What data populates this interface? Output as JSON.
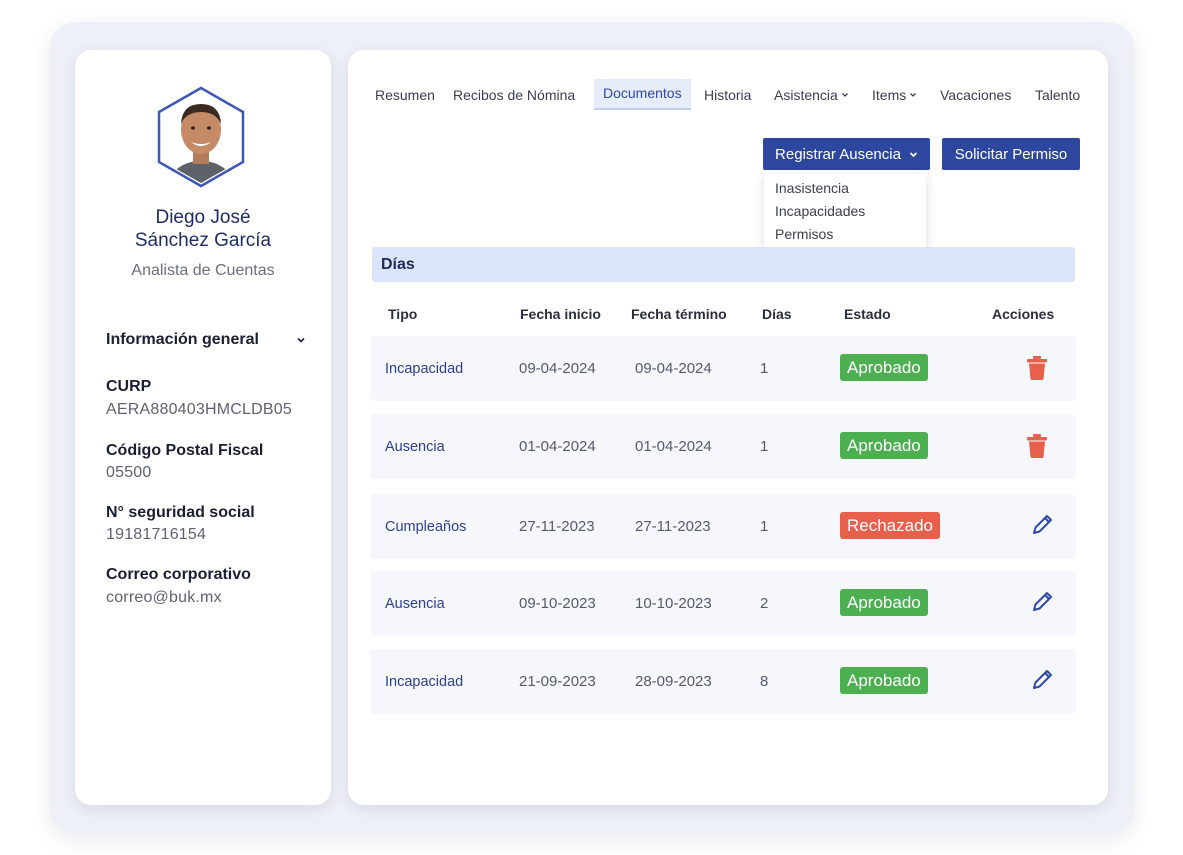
{
  "profile": {
    "first_name": "Diego José",
    "last_name": "Sánchez García",
    "role": "Analista de Cuentas",
    "info_header": "Información general",
    "fields": [
      {
        "label": "CURP",
        "value": "AERA880403HMCLDB05"
      },
      {
        "label": "Código Postal Fiscal",
        "value": "05500"
      },
      {
        "label": "N° seguridad social",
        "value": "19181716154"
      },
      {
        "label": "Correo corporativo",
        "value": "correo@buk.mx"
      }
    ]
  },
  "tabs": [
    {
      "label": "Resumen"
    },
    {
      "label": "Recibos de Nómina"
    },
    {
      "label": "Documentos",
      "active": true
    },
    {
      "label": "Historia"
    },
    {
      "label": "Asistencia",
      "dropdown": true
    },
    {
      "label": "Items",
      "dropdown": true
    },
    {
      "label": "Vacaciones"
    },
    {
      "label": "Talento"
    }
  ],
  "actions": {
    "register_label": "Registrar Ausencia",
    "permit_label": "Solicitar Permiso",
    "dropdown_items": [
      "Inasistencia",
      "Incapacidades",
      "Permisos"
    ]
  },
  "section": {
    "title": "Días",
    "columns": [
      "Tipo",
      "Fecha inicio",
      "Fecha término",
      "Días",
      "Estado",
      "Acciones"
    ],
    "rows": [
      {
        "type": "Incapacidad",
        "start": "09-04-2024",
        "end": "09-04-2024",
        "days": "1",
        "status": "Aprobado",
        "action_icon": "trash-icon"
      },
      {
        "type": "Ausencia",
        "start": "01-04-2024",
        "end": "01-04-2024",
        "days": "1",
        "status": "Aprobado",
        "action_icon": "trash-icon"
      },
      {
        "type": "Cumpleaños",
        "start": "27-11-2023",
        "end": "27-11-2023",
        "days": "1",
        "status": "Rechazado",
        "action_icon": "pencil-icon"
      },
      {
        "type": "Ausencia",
        "start": "09-10-2023",
        "end": "10-10-2023",
        "days": "2",
        "status": "Aprobado",
        "action_icon": "pencil-icon"
      },
      {
        "type": "Incapacidad",
        "start": "21-09-2023",
        "end": "28-09-2023",
        "days": "8",
        "status": "Aprobado",
        "action_icon": "pencil-icon"
      }
    ]
  },
  "colors": {
    "primary": "#2e479e",
    "approved": "#4caf50",
    "rejected": "#e8604c",
    "trash": "#e8604c",
    "pencil": "#2f4aa8"
  }
}
